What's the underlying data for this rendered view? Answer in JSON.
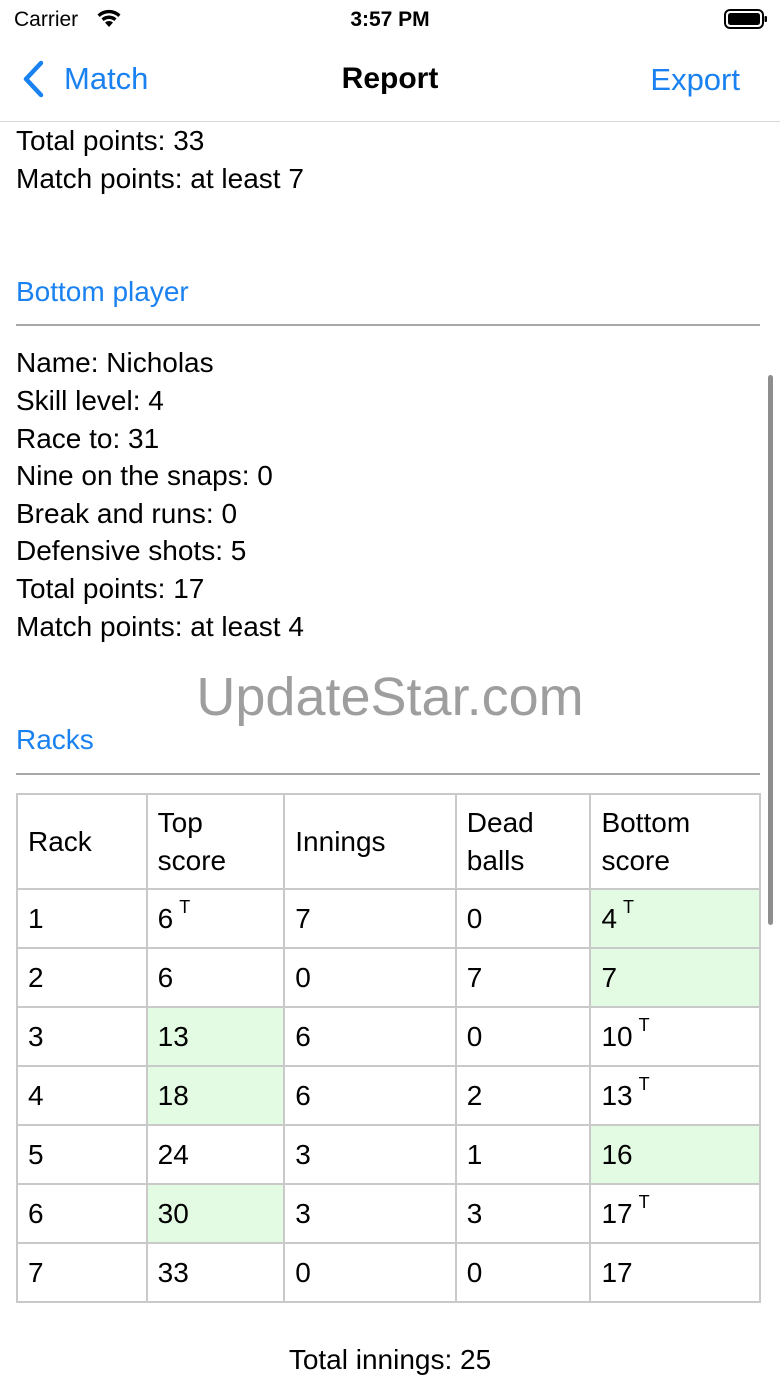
{
  "status_bar": {
    "carrier": "Carrier",
    "time": "3:57 PM"
  },
  "nav": {
    "back_label": "Match",
    "title": "Report",
    "export_label": "Export"
  },
  "top_summary": [
    "Total points: 33",
    "Match points: at least 7"
  ],
  "bottom_player": {
    "header": "Bottom player",
    "lines": [
      "Name: Nicholas",
      "Skill level: 4",
      "Race to: 31",
      "Nine on the snaps: 0",
      "Break and runs: 0",
      "Defensive shots: 5",
      "Total points: 17",
      "Match points: at least 4"
    ]
  },
  "watermark": "UpdateStar.com",
  "racks": {
    "header": "Racks",
    "columns": [
      "Rack",
      "Top score",
      "Innings",
      "Dead balls",
      "Bottom score"
    ],
    "rows": [
      {
        "rack": "1",
        "top": "6",
        "top_timeout": true,
        "top_win": false,
        "innings": "7",
        "dead": "0",
        "bottom": "4",
        "bottom_timeout": true,
        "bottom_win": true
      },
      {
        "rack": "2",
        "top": "6",
        "top_timeout": false,
        "top_win": false,
        "innings": "0",
        "dead": "7",
        "bottom": "7",
        "bottom_timeout": false,
        "bottom_win": true
      },
      {
        "rack": "3",
        "top": "13",
        "top_timeout": false,
        "top_win": true,
        "innings": "6",
        "dead": "0",
        "bottom": "10",
        "bottom_timeout": true,
        "bottom_win": false
      },
      {
        "rack": "4",
        "top": "18",
        "top_timeout": false,
        "top_win": true,
        "innings": "6",
        "dead": "2",
        "bottom": "13",
        "bottom_timeout": true,
        "bottom_win": false
      },
      {
        "rack": "5",
        "top": "24",
        "top_timeout": false,
        "top_win": false,
        "innings": "3",
        "dead": "1",
        "bottom": "16",
        "bottom_timeout": false,
        "bottom_win": true
      },
      {
        "rack": "6",
        "top": "30",
        "top_timeout": false,
        "top_win": true,
        "innings": "3",
        "dead": "3",
        "bottom": "17",
        "bottom_timeout": true,
        "bottom_win": false
      },
      {
        "rack": "7",
        "top": "33",
        "top_timeout": false,
        "top_win": false,
        "innings": "0",
        "dead": "0",
        "bottom": "17",
        "bottom_timeout": false,
        "bottom_win": false
      }
    ],
    "timeout_mark": "T",
    "total_innings": "Total innings: 25"
  },
  "colors": {
    "accent": "#1a82f0",
    "win_cell": "#e3fbe3"
  }
}
